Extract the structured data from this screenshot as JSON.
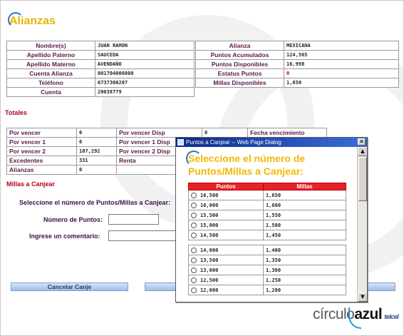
{
  "page": {
    "title": "Alianzas"
  },
  "client": {
    "rows": [
      {
        "label": "Nombre(s)",
        "value": "JUAN RAMON"
      },
      {
        "label": "Apellido Paterno",
        "value": "SAUCEDA"
      },
      {
        "label": "Apellido Materno",
        "value": "AVENDAÑO"
      },
      {
        "label": "Cuenta Alianza",
        "value": "001704006000"
      },
      {
        "label": "Teléfono",
        "value": "6737300207"
      },
      {
        "label": "Cuenta",
        "value": "20038779"
      }
    ]
  },
  "points_summary": {
    "rows": [
      {
        "label": "Alianza",
        "value": "MEXICANA"
      },
      {
        "label": "Puntos Acumulados",
        "value": "124,565"
      },
      {
        "label": "Puntos Disponibles",
        "value": "16,998"
      },
      {
        "label": "Estatus Puntos",
        "value": "0"
      },
      {
        "label": "Millas Disponibles",
        "value": "1,650"
      }
    ]
  },
  "totales": {
    "title": "Totales",
    "rows": [
      {
        "label": "Por vencer",
        "value": "0",
        "label2": "Por vencer Disp",
        "value2": "0",
        "label3": "Fecha vencimiento"
      },
      {
        "label": "Por vencer 1",
        "value": "0",
        "label2": "Por vencer 1 Disp",
        "value2": "",
        "label3": ""
      },
      {
        "label": "Por vencer 2",
        "value": "107,292",
        "label2": "Por vencer 2 Disp",
        "value2": "",
        "label3": ""
      },
      {
        "label": "Excedentes",
        "value": "331",
        "label2": "Renta",
        "value2": "",
        "label3": ""
      },
      {
        "label": "Alianzas",
        "value": "0",
        "label2": "",
        "value2": "",
        "label3": ""
      }
    ]
  },
  "millas_form": {
    "title": "Millas a Canjear",
    "prompt": "Seleccione el número de Puntos/Millas a Canjear:",
    "points_label": "Número de Puntos:",
    "points_value": "",
    "comment_label": "Ingrese un comentario:",
    "comment_value": "",
    "cancel_label": "Cancelar Canje"
  },
  "dialog": {
    "title": "Puntos a Canjear -- Web Page Dialog",
    "close_glyph": "×",
    "heading": "Seleccione el número de Puntos/Millas a Canjear:",
    "col_points": "Puntos",
    "col_miles": "Millas",
    "group1": [
      {
        "puntos": "16,500",
        "millas": "1,650"
      },
      {
        "puntos": "16,000",
        "millas": "1,600"
      },
      {
        "puntos": "15,500",
        "millas": "1,550"
      },
      {
        "puntos": "15,000",
        "millas": "1,500"
      },
      {
        "puntos": "14,500",
        "millas": "1,450"
      }
    ],
    "group2": [
      {
        "puntos": "14,000",
        "millas": "1,400"
      },
      {
        "puntos": "13,500",
        "millas": "1,350"
      },
      {
        "puntos": "13,000",
        "millas": "1,300"
      },
      {
        "puntos": "12,500",
        "millas": "1,250"
      },
      {
        "puntos": "12,000",
        "millas": "1,200"
      }
    ]
  },
  "brand": {
    "logo_part1": "círculo",
    "logo_part2": "azul",
    "logo_part3": "telcel"
  },
  "colors": {
    "title_yellow": "#e8b500",
    "section_red": "#b4001e",
    "header_red": "#e8222a",
    "dialog_blue": "#0b2a8c"
  }
}
